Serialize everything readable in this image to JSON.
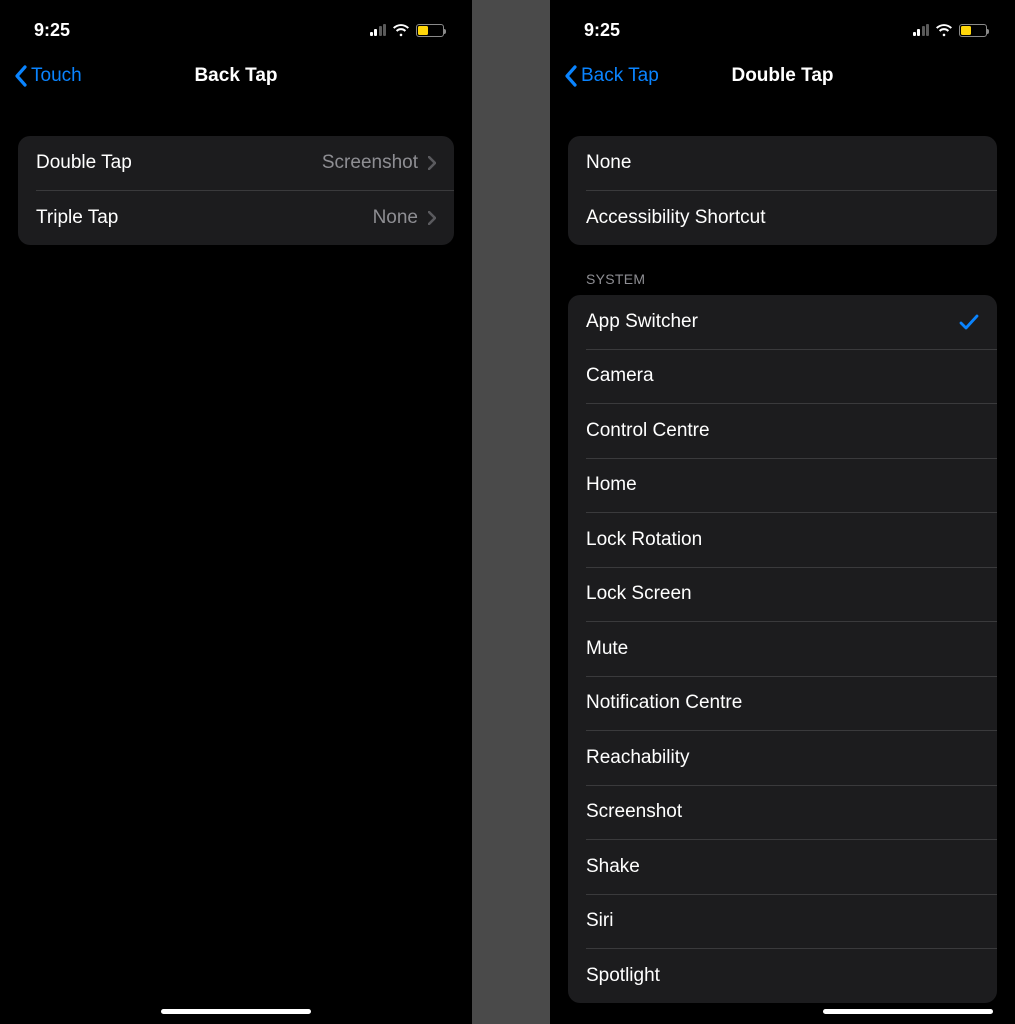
{
  "status": {
    "time": "9:25"
  },
  "left": {
    "back_label": "Touch",
    "title": "Back Tap",
    "rows": [
      {
        "label": "Double Tap",
        "value": "Screenshot"
      },
      {
        "label": "Triple Tap",
        "value": "None"
      }
    ]
  },
  "right": {
    "back_label": "Back Tap",
    "title": "Double Tap",
    "group1": [
      {
        "label": "None"
      },
      {
        "label": "Accessibility Shortcut"
      }
    ],
    "system_header": "SYSTEM",
    "system": [
      {
        "label": "App Switcher",
        "selected": true
      },
      {
        "label": "Camera"
      },
      {
        "label": "Control Centre"
      },
      {
        "label": "Home"
      },
      {
        "label": "Lock Rotation"
      },
      {
        "label": "Lock Screen"
      },
      {
        "label": "Mute"
      },
      {
        "label": "Notification Centre"
      },
      {
        "label": "Reachability"
      },
      {
        "label": "Screenshot"
      },
      {
        "label": "Shake"
      },
      {
        "label": "Siri"
      },
      {
        "label": "Spotlight"
      }
    ]
  }
}
